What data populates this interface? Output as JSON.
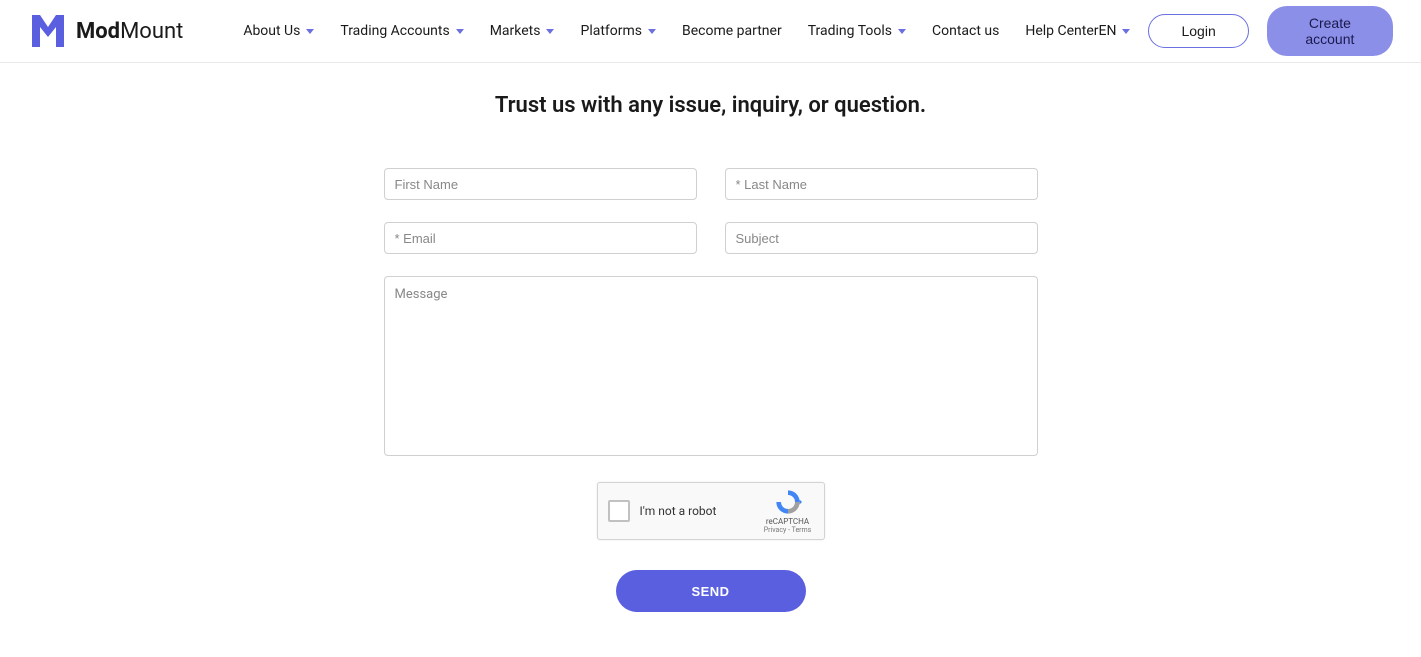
{
  "brand": {
    "name_bold": "Mod",
    "name_light": "Mount"
  },
  "nav": {
    "items": [
      {
        "label": "About Us",
        "dropdown": true
      },
      {
        "label": "Trading Accounts",
        "dropdown": true
      },
      {
        "label": "Markets",
        "dropdown": true
      },
      {
        "label": "Platforms",
        "dropdown": true
      },
      {
        "label": "Become partner",
        "dropdown": false
      },
      {
        "label": "Trading Tools",
        "dropdown": true
      },
      {
        "label": "Contact us",
        "dropdown": false
      },
      {
        "label": "Help Center",
        "dropdown": false
      }
    ]
  },
  "header": {
    "language": "EN",
    "login_label": "Login",
    "create_label": "Create account"
  },
  "page": {
    "subtitle": "Trust us with any issue, inquiry, or question."
  },
  "form": {
    "first_name_placeholder": "First Name",
    "last_name_placeholder": "* Last Name",
    "email_placeholder": "* Email",
    "subject_placeholder": "Subject",
    "message_placeholder": "Message",
    "send_label": "SEND"
  },
  "recaptcha": {
    "label": "I'm not a robot",
    "brand": "reCAPTCHA",
    "links": "Privacy - Terms"
  }
}
